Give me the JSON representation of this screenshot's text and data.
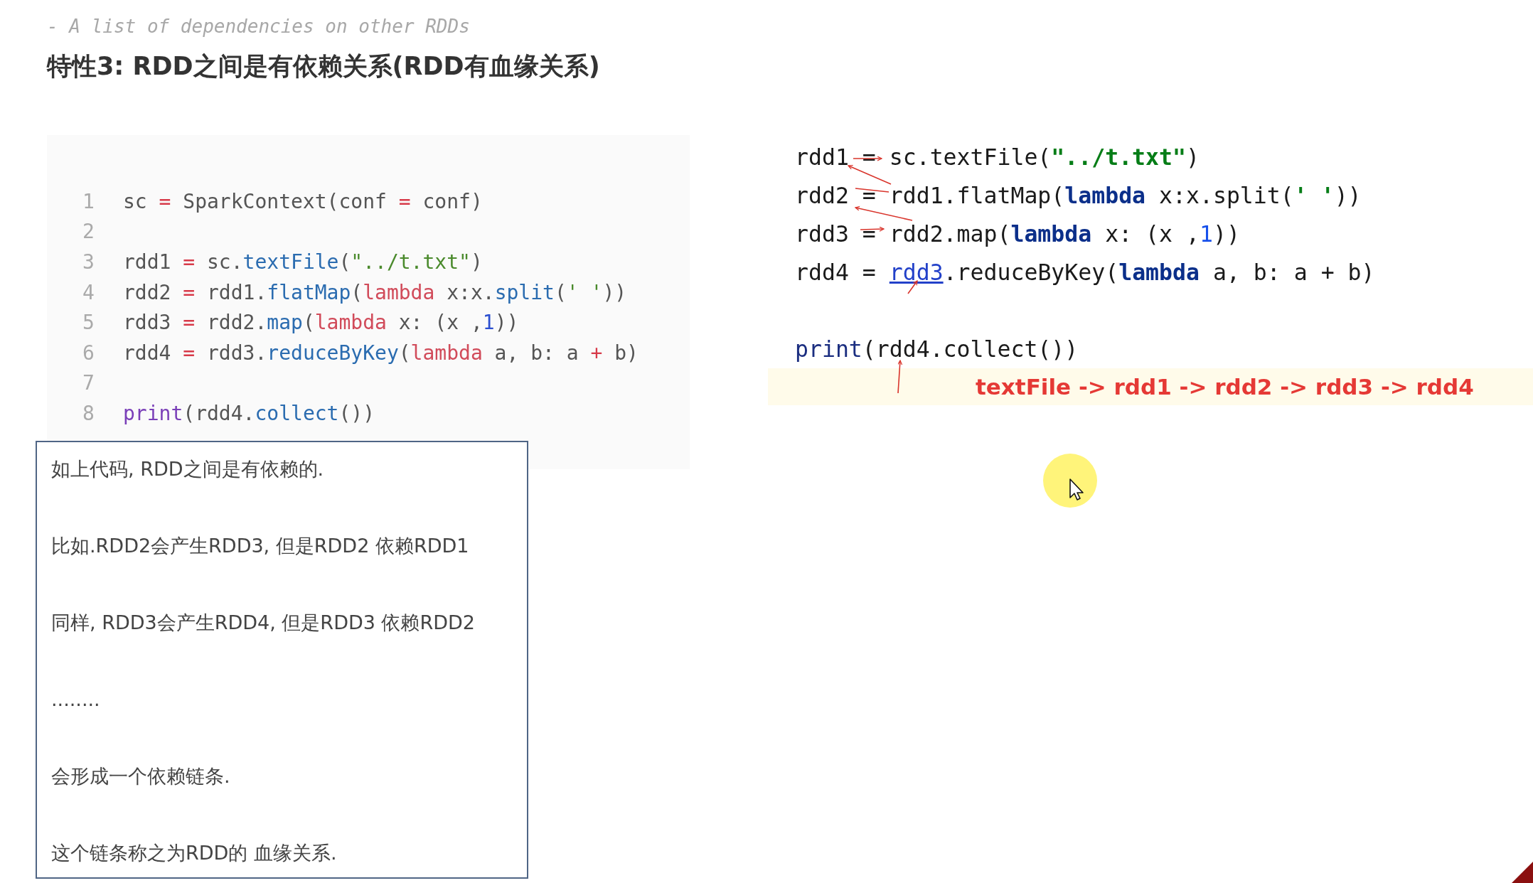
{
  "subtitle": "- A list of dependencies on other RDDs",
  "heading": "特性3: RDD之间是有依赖关系(RDD有血缘关系)",
  "code_block": {
    "lines": [
      {
        "number": "1",
        "tokens": [
          {
            "kind": "plain",
            "text": "sc "
          },
          {
            "kind": "op",
            "text": "="
          },
          {
            "kind": "plain",
            "text": " SparkContext(conf "
          },
          {
            "kind": "op",
            "text": "="
          },
          {
            "kind": "plain",
            "text": " conf)"
          }
        ]
      },
      {
        "number": "2"
      },
      {
        "number": "3",
        "tokens": [
          {
            "kind": "plain",
            "text": "rdd1 "
          },
          {
            "kind": "op",
            "text": "="
          },
          {
            "kind": "plain",
            "text": " sc."
          },
          {
            "kind": "func",
            "text": "textFile"
          },
          {
            "kind": "plain",
            "text": "("
          },
          {
            "kind": "string",
            "text": "\"../t.txt\""
          },
          {
            "kind": "plain",
            "text": ")"
          }
        ]
      },
      {
        "number": "4",
        "tokens": [
          {
            "kind": "plain",
            "text": "rdd2 "
          },
          {
            "kind": "op",
            "text": "="
          },
          {
            "kind": "plain",
            "text": " rdd1."
          },
          {
            "kind": "func",
            "text": "flatMap"
          },
          {
            "kind": "plain",
            "text": "("
          },
          {
            "kind": "keyword",
            "text": "lambda"
          },
          {
            "kind": "plain",
            "text": " x:x."
          },
          {
            "kind": "func",
            "text": "split"
          },
          {
            "kind": "plain",
            "text": "("
          },
          {
            "kind": "string",
            "text": "' '"
          },
          {
            "kind": "plain",
            "text": "))"
          }
        ]
      },
      {
        "number": "5",
        "tokens": [
          {
            "kind": "plain",
            "text": "rdd3 "
          },
          {
            "kind": "op",
            "text": "="
          },
          {
            "kind": "plain",
            "text": " rdd2."
          },
          {
            "kind": "func",
            "text": "map"
          },
          {
            "kind": "plain",
            "text": "("
          },
          {
            "kind": "keyword",
            "text": "lambda"
          },
          {
            "kind": "plain",
            "text": " x: (x ,"
          },
          {
            "kind": "number",
            "text": "1"
          },
          {
            "kind": "plain",
            "text": "))"
          }
        ]
      },
      {
        "number": "6",
        "tokens": [
          {
            "kind": "plain",
            "text": "rdd4 "
          },
          {
            "kind": "op",
            "text": "="
          },
          {
            "kind": "plain",
            "text": " rdd3."
          },
          {
            "kind": "func",
            "text": "reduceByKey"
          },
          {
            "kind": "plain",
            "text": "("
          },
          {
            "kind": "keyword",
            "text": "lambda"
          },
          {
            "kind": "plain",
            "text": " a, b: a "
          },
          {
            "kind": "op",
            "text": "+"
          },
          {
            "kind": "plain",
            "text": " b)"
          }
        ]
      },
      {
        "number": "7"
      },
      {
        "number": "8",
        "tokens": [
          {
            "kind": "builtin",
            "text": "print"
          },
          {
            "kind": "plain",
            "text": "(rdd4."
          },
          {
            "kind": "func",
            "text": "collect"
          },
          {
            "kind": "plain",
            "text": "())"
          }
        ]
      }
    ]
  },
  "note_box": {
    "paragraphs": [
      "如上代码, RDD之间是有依赖的.",
      "比如.RDD2会产生RDD3, 但是RDD2 依赖RDD1",
      "同样, RDD3会产生RDD4, 但是RDD3 依赖RDD2",
      "........",
      "会形成一个依赖链条.",
      "这个链条称之为RDD的 血缘关系."
    ]
  },
  "editor_code": {
    "lines": [
      {
        "kind": "code",
        "tokens": [
          {
            "kind": "plain",
            "text": "rdd1 = sc.textFile("
          },
          {
            "kind": "string",
            "text": "\"../t.txt\""
          },
          {
            "kind": "plain",
            "text": ")"
          }
        ]
      },
      {
        "kind": "code",
        "tokens": [
          {
            "kind": "plain",
            "text": "rdd2 = rdd1.flatMap("
          },
          {
            "kind": "keyword",
            "text": "lambda"
          },
          {
            "kind": "plain",
            "text": " x:x.split("
          },
          {
            "kind": "string",
            "text": "' '"
          },
          {
            "kind": "plain",
            "text": "))"
          }
        ]
      },
      {
        "kind": "code",
        "tokens": [
          {
            "kind": "plain",
            "text": "rdd3 = rdd2.map("
          },
          {
            "kind": "keyword",
            "text": "lambda"
          },
          {
            "kind": "plain",
            "text": " x: (x ,"
          },
          {
            "kind": "number",
            "text": "1"
          },
          {
            "kind": "plain",
            "text": "))"
          }
        ]
      },
      {
        "kind": "code",
        "tokens": [
          {
            "kind": "plain",
            "text": "rdd4 = "
          },
          {
            "kind": "link",
            "text": "rdd3"
          },
          {
            "kind": "plain",
            "text": ".reduceByKey("
          },
          {
            "kind": "keyword",
            "text": "lambda"
          },
          {
            "kind": "plain",
            "text": " a, b: a + b)"
          }
        ]
      },
      {
        "kind": "blank"
      },
      {
        "kind": "code",
        "tokens": [
          {
            "kind": "builtin",
            "text": "print"
          },
          {
            "kind": "plain",
            "text": "(rdd4.collect())"
          }
        ]
      }
    ],
    "highlighted_line": "textFile -> rdd1 -> rdd2 -> rdd3 -> rdd4"
  }
}
